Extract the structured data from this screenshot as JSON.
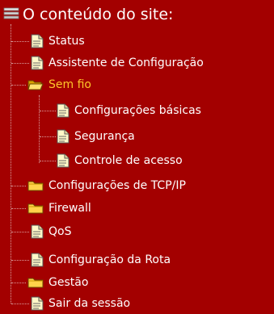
{
  "title": "O conteúdo do site:",
  "colors": {
    "background": "#a30000",
    "text": "#ffffff",
    "active": "#ffc629"
  },
  "items": [
    {
      "label": "Status",
      "icon": "document-icon"
    },
    {
      "label": "Assistente de Configuração",
      "icon": "document-icon"
    },
    {
      "label": "Sem fio",
      "icon": "folder-open-icon",
      "active": true
    },
    {
      "label": "Configurações básicas",
      "icon": "document-icon"
    },
    {
      "label": "Segurança",
      "icon": "document-icon"
    },
    {
      "label": "Controle de acesso",
      "icon": "document-icon"
    },
    {
      "label": "Configurações de TCP/IP",
      "icon": "folder-icon"
    },
    {
      "label": "Firewall",
      "icon": "folder-icon"
    },
    {
      "label": "QoS",
      "icon": "document-icon"
    },
    {
      "label": "Configuração da Rota",
      "icon": "document-icon"
    },
    {
      "label": "Gestão",
      "icon": "folder-icon"
    },
    {
      "label": "Sair da sessão",
      "icon": "document-icon"
    }
  ]
}
